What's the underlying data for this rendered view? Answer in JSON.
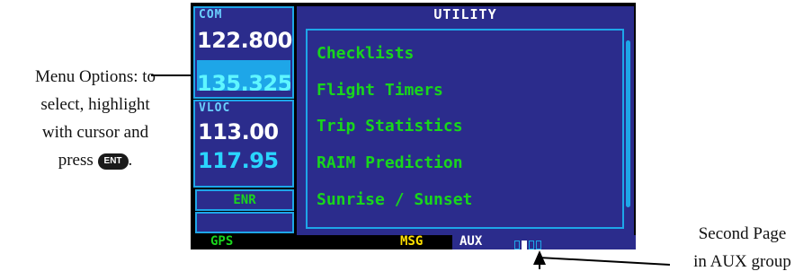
{
  "left_callout": {
    "lines": [
      "Menu Options: to",
      "select, highlight",
      "with cursor and",
      "press"
    ],
    "key_label": "ENT",
    "tail": "."
  },
  "right_callout": {
    "lines": [
      "Second Page",
      "in AUX group"
    ]
  },
  "screen": {
    "com_label": "COM",
    "com_active": "122.800",
    "com_standby": "135.325",
    "vloc_label": "VLOC",
    "vloc_active": "113.00",
    "vloc_standby": "117.95",
    "mode": "ENR",
    "title": "UTILITY",
    "menu_items": [
      "Checklists",
      "Flight Timers",
      "Trip Statistics",
      "RAIM Prediction",
      "Sunrise / Sunset"
    ],
    "status": {
      "gps": "GPS",
      "msg": "MSG",
      "group": "AUX",
      "page_count": 4,
      "current_page": 2
    }
  },
  "colors": {
    "panel_bg": "#2b2c8c",
    "panel_border": "#1ea6e8",
    "menu_text": "#19d61c",
    "label_text": "#6ad0ff",
    "msg_text": "#ffe000",
    "status_bg": "#000000"
  }
}
